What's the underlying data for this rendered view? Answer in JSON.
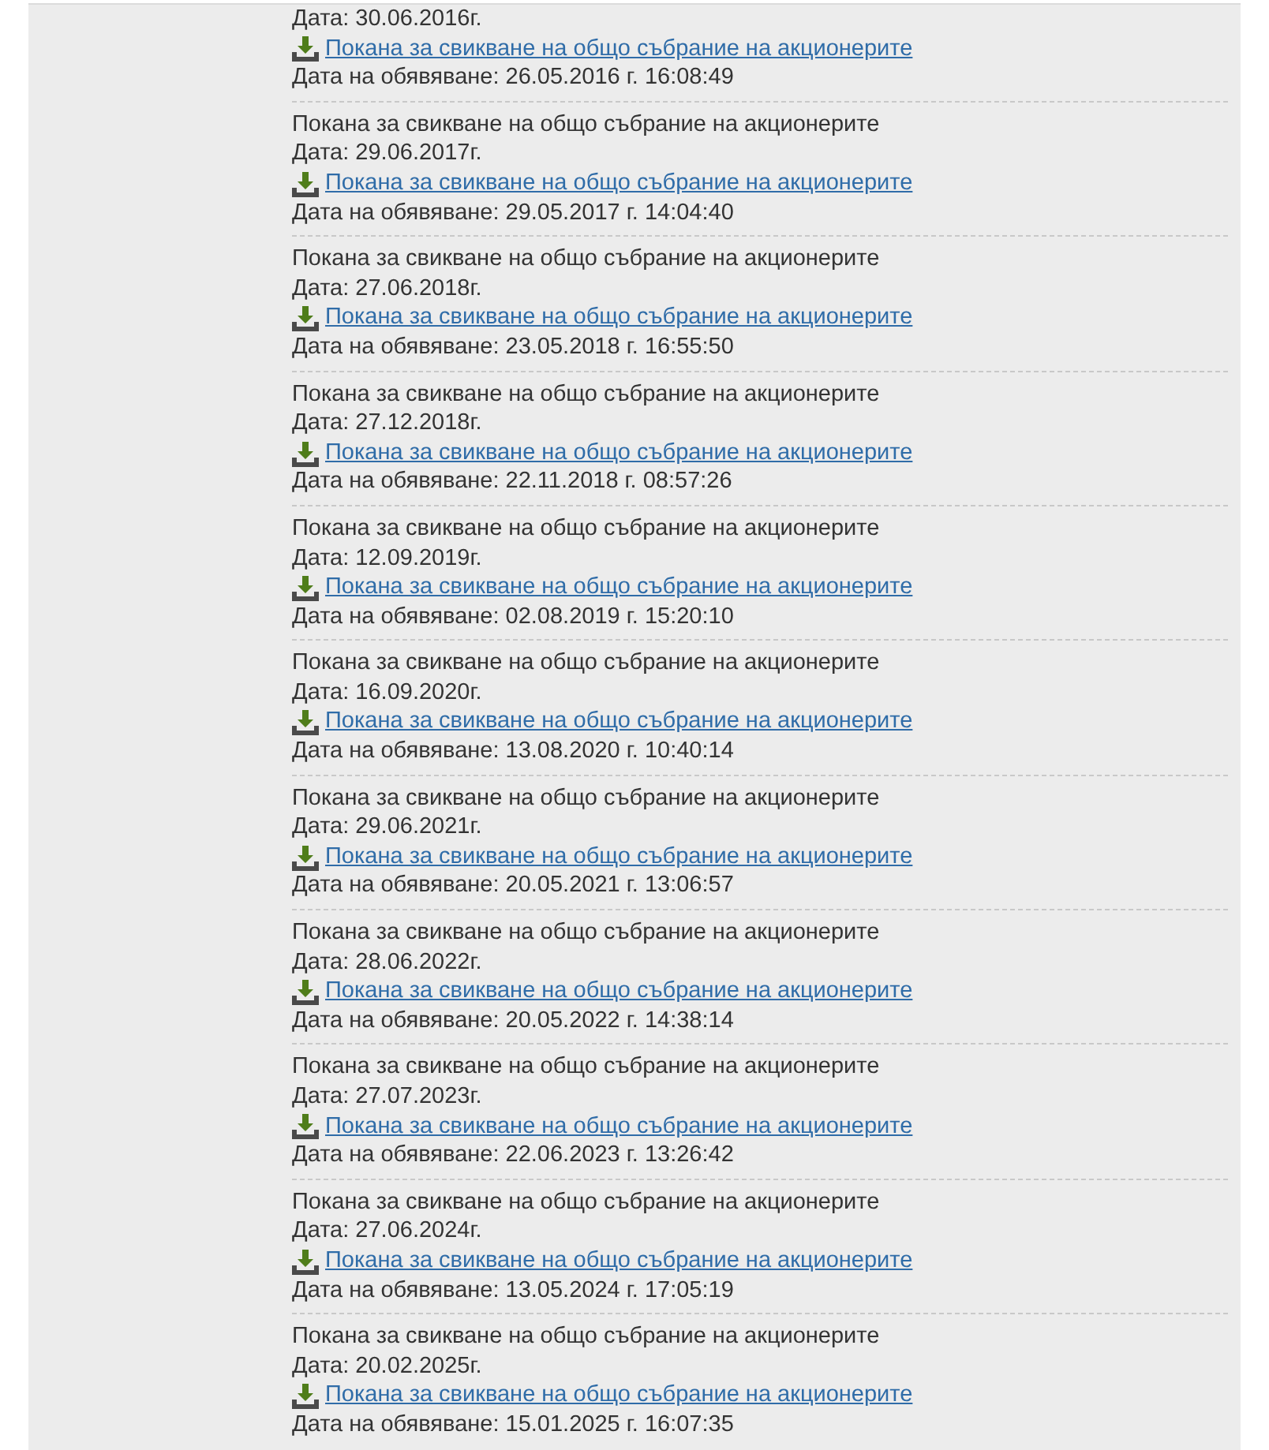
{
  "notices": [
    {
      "date": "Дата: 30.06.2016г.",
      "link": "Покана за свикване на общо събрание на акционерите",
      "announced": "Дата на обявяване: 26.05.2016 г. 16:08:49"
    },
    {
      "title": "Покана за свикване на общо събрание на акционерите",
      "date": "Дата: 29.06.2017г.",
      "link": "Покана за свикване на общо събрание на акционерите",
      "announced": "Дата на обявяване: 29.05.2017 г. 14:04:40"
    },
    {
      "title": "Покана за свикване на общо събрание на акционерите",
      "date": "Дата: 27.06.2018г.",
      "link": "Покана за свикване на общо събрание на акционерите",
      "announced": "Дата на обявяване: 23.05.2018 г. 16:55:50"
    },
    {
      "title": "Покана за свикване на общо събрание на акционерите",
      "date": "Дата: 27.12.2018г.",
      "link": "Покана за свикване на общо събрание на акционерите",
      "announced": "Дата на обявяване: 22.11.2018 г. 08:57:26"
    },
    {
      "title": "Покана за свикване на общо събрание на акционерите",
      "date": "Дата: 12.09.2019г.",
      "link": "Покана за свикване на общо събрание на акционерите",
      "announced": "Дата на обявяване: 02.08.2019 г. 15:20:10"
    },
    {
      "title": "Покана за свикване на общо събрание на акционерите",
      "date": "Дата: 16.09.2020г.",
      "link": "Покана за свикване на общо събрание на акционерите",
      "announced": "Дата на обявяване: 13.08.2020 г. 10:40:14"
    },
    {
      "title": "Покана за свикване на общо събрание на акционерите",
      "date": "Дата: 29.06.2021г.",
      "link": "Покана за свикване на общо събрание на акционерите",
      "announced": "Дата на обявяване: 20.05.2021 г. 13:06:57"
    },
    {
      "title": "Покана за свикване на общо събрание на акционерите",
      "date": "Дата: 28.06.2022г.",
      "link": "Покана за свикване на общо събрание на акционерите",
      "announced": "Дата на обявяване: 20.05.2022 г. 14:38:14"
    },
    {
      "title": "Покана за свикване на общо събрание на акционерите",
      "date": "Дата: 27.07.2023г.",
      "link": "Покана за свикване на общо събрание на акционерите",
      "announced": "Дата на обявяване: 22.06.2023 г. 13:26:42"
    },
    {
      "title": "Покана за свикване на общо събрание на акционерите",
      "date": "Дата: 27.06.2024г.",
      "link": "Покана за свикване на общо събрание на акционерите",
      "announced": "Дата на обявяване: 13.05.2024 г. 17:05:19"
    },
    {
      "title": "Покана за свикване на общо събрание на акционерите",
      "date": "Дата: 20.02.2025г.",
      "link": "Покана за свикване на общо събрание на акционерите",
      "announced": "Дата на обявяване: 15.01.2025 г. 16:07:35"
    }
  ]
}
